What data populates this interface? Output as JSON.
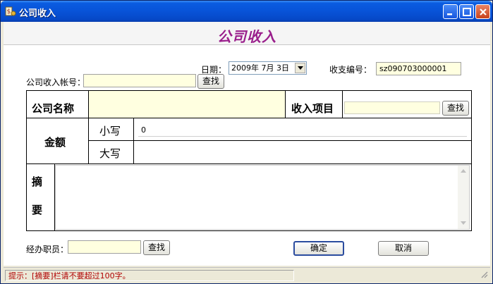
{
  "window": {
    "title": "公司收入",
    "header": "公司收入"
  },
  "top": {
    "date_label": "日期：",
    "date_value": "2009年 7月 3日",
    "serial_label": "收支编号：",
    "serial_value": "sz090703000001",
    "account_label": "公司收入帐号：",
    "account_value": "",
    "account_find": "查找"
  },
  "grid": {
    "company_name_label": "公司名称",
    "company_name_value": "",
    "income_item_label": "收入项目",
    "income_item_value": "",
    "income_item_find": "查找",
    "amount_label": "金额",
    "lower_label": "小写",
    "lower_value": "0",
    "upper_label": "大写",
    "upper_value": "",
    "memo_label_1": "摘",
    "memo_label_2": "要",
    "memo_value": ""
  },
  "bottom": {
    "staff_label": "经办职员：",
    "staff_value": "",
    "staff_find": "查找",
    "ok_label": "确定",
    "cancel_label": "取消"
  },
  "status": {
    "hint": "提示：[摘要]栏请不要超过100字。"
  },
  "colors": {
    "header_text": "#9a1f8c",
    "field_bg": "#ffffe0",
    "hint_text": "#b00000"
  }
}
